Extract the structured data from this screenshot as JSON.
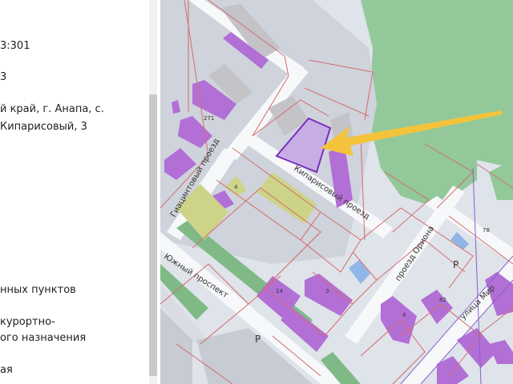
{
  "panel": {
    "lines": [
      "3:301",
      "3",
      "й край, г. Анапа, с.",
      "Кипарисовый, 3",
      "нных пунктов",
      "курортно-",
      "ого назначения",
      "ая"
    ]
  },
  "map": {
    "colors": {
      "background": "#dfe3ea",
      "forest": "#93c99a",
      "building": "#b26fd6",
      "building_grey": "#c3c3c8",
      "yellow_parcel": "#cdd488",
      "boundary": "#d66b6b",
      "selected": "#7a2fc0",
      "arrow": "#f5c33b",
      "road": "#f7f8fa",
      "rail": "#7fba86",
      "water": "#8fb6e6"
    },
    "streets": {
      "giacintovy": "Гиацинтовый проезд",
      "kiparisovy": "Кипарисовый проезд",
      "yuzhny": "Южный проспект",
      "oriona": "проезд Ориона",
      "ulitsa_mir": "улица Мир"
    },
    "house_numbers": {
      "n271": "271",
      "n4": "4",
      "n14": "14",
      "n3": "3",
      "n78": "78",
      "n82": "82",
      "n4b": "4"
    },
    "parking": {
      "p1": "P",
      "p2": "P"
    }
  }
}
